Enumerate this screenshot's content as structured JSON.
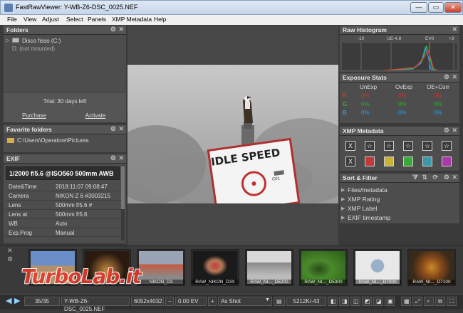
{
  "window": {
    "title": "FastRawViewer: Y-WB-Z6-DSC_0025.NEF",
    "min": "—",
    "max": "▭",
    "close": "✕"
  },
  "menu": [
    "File",
    "View",
    "Adjust",
    "Select",
    "Panels",
    "XMP Metadata",
    "Help"
  ],
  "folders": {
    "title": "Folders",
    "drive": "Disco fisso (C:)",
    "drive2": "D: (not mounted)"
  },
  "trial": {
    "text": "Trial: 30 days left",
    "purchase": "Purchase",
    "activate": "Activate"
  },
  "favorites": {
    "title": "Favorite folders",
    "path": "C:\\Users\\Operatore\\Pictures"
  },
  "exif": {
    "title": "EXIF",
    "summary": "1/2000 f/5.6 @ISO560 500mm AWB",
    "rows": [
      {
        "k": "Date&Time",
        "v": "2018:11:07 09:08:47"
      },
      {
        "k": "Camera",
        "v": "NIKON Z 6 #3003215"
      },
      {
        "k": "Lens",
        "v": "500mm f/5.6 #"
      },
      {
        "k": "Lens at",
        "v": "500mm f/5.6"
      },
      {
        "k": "WB",
        "v": "Auto"
      },
      {
        "k": "Exp.Prog",
        "v": "Manual"
      }
    ]
  },
  "photo": {
    "sign_text": "IDLE SPEED",
    "sign_small": "C01"
  },
  "histogram": {
    "title": "Raw Histogram",
    "labels": [
      "-10",
      "UE-4.8",
      "EV0",
      "+3"
    ]
  },
  "exposure": {
    "title": "Exposure Stats",
    "cols": [
      "UnExp",
      "OvExp",
      "OE+Corr"
    ],
    "rows": [
      {
        "ch": "R",
        "vals": [
          "0%",
          "0%",
          "0%"
        ],
        "color": "#cc3333"
      },
      {
        "ch": "G",
        "vals": [
          "0%",
          "0%",
          "0%"
        ],
        "color": "#33aa33"
      },
      {
        "ch": "B",
        "vals": [
          "0%",
          "0%",
          "0%"
        ],
        "color": "#3399dd"
      }
    ]
  },
  "xmp": {
    "title": "XMP Metadata",
    "row1": [
      "X",
      "☆",
      "☆",
      "☆",
      "☆",
      "☆"
    ],
    "row2_first": "X",
    "labels": [
      "#c03a3a",
      "#c8b23a",
      "#3aa83a",
      "#3a9aa8",
      "#a83aa8"
    ]
  },
  "sort": {
    "title": "Sort & Filter",
    "items": [
      "Files/metadata",
      "XMP Rating",
      "XMP Label",
      "EXIF timestamp"
    ]
  },
  "filmstrip": [
    {
      "cap": "",
      "c1": "#6a8fc8",
      "c2": "#b4906a"
    },
    {
      "cap": "",
      "c1": "#2a1a10",
      "c2": "#c88a40"
    },
    {
      "cap": "NIKON_D3",
      "c1": "#9aa4b4",
      "c2": "#c85a40"
    },
    {
      "cap": "RAW_NIKON_D3X",
      "c1": "#1a1a1a",
      "c2": "#c83a3a"
    },
    {
      "cap": "RAW_NI..._D5200",
      "c1": "#d8d8d8",
      "c2": "#8a8a8a"
    },
    {
      "cap": "RAW_NI..._D5300",
      "c1": "#4a8a2a",
      "c2": "#2a5a1a"
    },
    {
      "cap": "RAW_NI..._D7000",
      "c1": "#e8e8e8",
      "c2": "#9ab0c8"
    },
    {
      "cap": "RAW_NI..._D7100",
      "c1": "#5a3a1a",
      "c2": "#c88a2a"
    }
  ],
  "status": {
    "count": "35/35",
    "filename": "Y-WB-Z6-DSC_0025.NEF",
    "size": "6052x4032",
    "ev": "0.00 EV",
    "wb": "As Shot",
    "mem": "5212K/-43"
  },
  "watermark": "TurboLab.it"
}
